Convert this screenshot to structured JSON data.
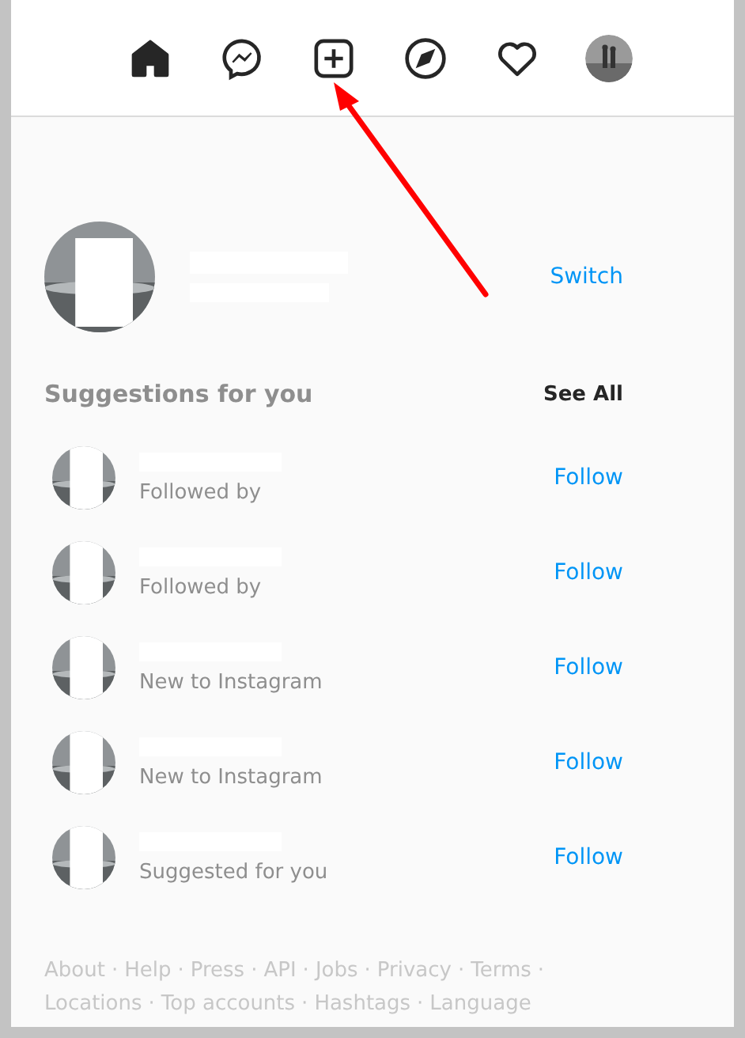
{
  "nav": {
    "items": [
      {
        "kind": "home",
        "selected": true
      },
      {
        "kind": "messenger",
        "selected": false
      },
      {
        "kind": "create",
        "selected": false
      },
      {
        "kind": "explore",
        "selected": false
      },
      {
        "kind": "activity",
        "selected": false
      },
      {
        "kind": "profile",
        "selected": false
      }
    ]
  },
  "account": {
    "action": "Switch"
  },
  "suggestions": {
    "title": "Suggestions for you",
    "see_all": "See All",
    "items": [
      {
        "subtitle": "Followed by",
        "action": "Follow"
      },
      {
        "subtitle": "Followed by",
        "action": "Follow"
      },
      {
        "subtitle": "New to Instagram",
        "action": "Follow"
      },
      {
        "subtitle": "New to Instagram",
        "action": "Follow"
      },
      {
        "subtitle": "Suggested for you",
        "action": "Follow"
      }
    ]
  },
  "footer": {
    "separator": "·",
    "links": [
      "About",
      "Help",
      "Press",
      "API",
      "Jobs",
      "Privacy",
      "Terms",
      "Locations",
      "Top accounts",
      "Hashtags",
      "Language"
    ]
  }
}
